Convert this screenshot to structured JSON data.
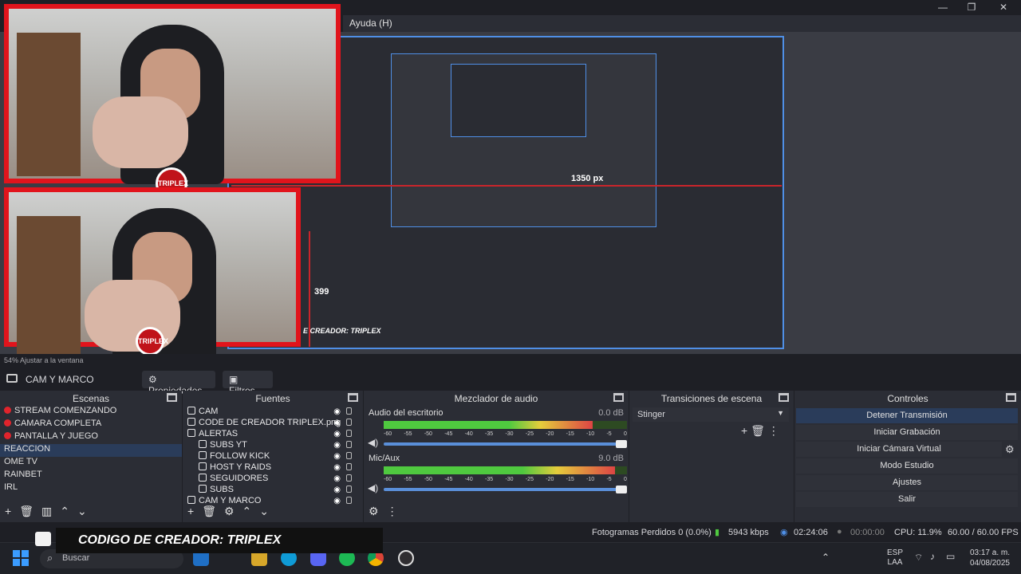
{
  "window": {
    "menu_help": "Ayuda (H)",
    "minimize": "—",
    "maximize": "❐",
    "close": "✕"
  },
  "preview": {
    "zoom_label": "54%  Ajustar a la ventana",
    "overlay_badge": "TRIPLEX",
    "nested_px_a": "1350 px",
    "nested_px_b": "399",
    "nested_banner": "E CREADOR: TRIPLEX"
  },
  "toolbar": {
    "scene_label": "CAM Y MARCO",
    "properties": "Propiedades",
    "filters": "Filtros"
  },
  "scenes": {
    "title": "Escenas",
    "items": [
      {
        "label": "STREAM COMENZANDO",
        "live": true
      },
      {
        "label": "CAMARA COMPLETA",
        "live": true
      },
      {
        "label": "PANTALLA Y JUEGO",
        "live": true
      },
      {
        "label": "REACCION",
        "live": false
      },
      {
        "label": "OME TV",
        "live": false
      },
      {
        "label": "RAINBET",
        "live": false
      },
      {
        "label": "IRL",
        "live": false
      }
    ]
  },
  "sources": {
    "title": "Fuentes",
    "items": [
      {
        "label": "CAM",
        "indent": 0
      },
      {
        "label": "CODE DE CREADOR TRIPLEX.png",
        "indent": 0
      },
      {
        "label": "ALERTAS",
        "indent": 0
      },
      {
        "label": "SUBS YT",
        "indent": 1
      },
      {
        "label": "FOLLOW KICK",
        "indent": 1
      },
      {
        "label": "HOST Y RAIDS",
        "indent": 1
      },
      {
        "label": "SEGUIDORES",
        "indent": 1
      },
      {
        "label": "SUBS",
        "indent": 1
      },
      {
        "label": "CAM Y MARCO",
        "indent": 0
      }
    ]
  },
  "mixer": {
    "title": "Mezclador de audio",
    "channels": [
      {
        "name": "Audio del escritorio",
        "db": "0.0 dB",
        "level": 0.86
      },
      {
        "name": "Mic/Aux",
        "db": "9.0 dB",
        "level": 0.95
      }
    ],
    "ticks": [
      "-60",
      "-55",
      "-50",
      "-45",
      "-40",
      "-35",
      "-30",
      "-25",
      "-20",
      "-15",
      "-10",
      "-5",
      "0"
    ]
  },
  "transitions": {
    "title": "Transiciones de escena",
    "selected": "Stinger"
  },
  "controls": {
    "title": "Controles",
    "buttons": [
      "Detener Transmisión",
      "Iniciar Grabación",
      "Iniciar Cámara Virtual",
      "Modo Estudio",
      "Ajustes",
      "Salir"
    ]
  },
  "status": {
    "dropped": "Fotogramas Perdidos 0 (0.0%)",
    "kbps": "5943 kbps",
    "live_time": "02:24:06",
    "rec_time": "00:00:00",
    "cpu": "CPU: 11.9%",
    "fps": "60.00 / 60.00 FPS"
  },
  "overlay": {
    "creator_code": "CODIGO DE CREADOR: TRIPLEX"
  },
  "taskbar": {
    "search_placeholder": "Buscar",
    "lang": "ESP",
    "lang2": "LAA",
    "time": "03:17 a. m.",
    "date": "04/08/2025"
  }
}
